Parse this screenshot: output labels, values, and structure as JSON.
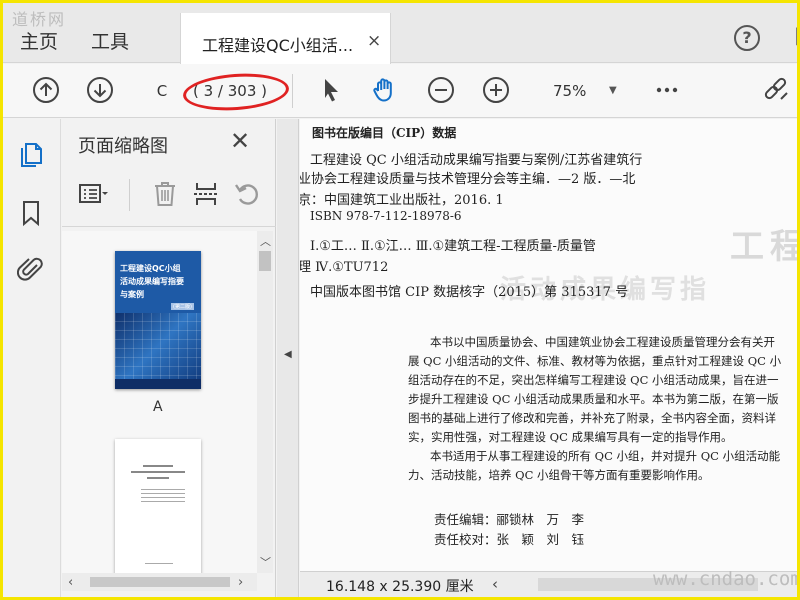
{
  "watermark_top": "道桥网",
  "watermark_bottom": "www.cndao.com",
  "top_tabs": {
    "home": "主页",
    "tools": "工具"
  },
  "document_tab": {
    "title": "工程建设QC小组活...",
    "close": "×"
  },
  "help": "?",
  "toolbar": {
    "current_page": "C",
    "page_count": "( 3 / 303 )",
    "zoom": "75%"
  },
  "panel": {
    "title": "页面缩略图",
    "close": "✕",
    "thumbnails": [
      {
        "label": "A",
        "cover_lines": [
          "工程建设QC小组",
          "活动成果编写指要",
          "与案例"
        ],
        "edition": "(第二版)"
      },
      {
        "label": ""
      }
    ]
  },
  "document": {
    "cip_lines": [
      "图书在版编目（CIP）数据",
      "工程建设 QC 小组活动成果编写指要与案例/江苏省建筑行",
      "业协会工程建设质量与技术管理分会等主编．—2 版．—北",
      "京：中国建筑工业出版社，2016. 1",
      "ISBN 978-7-112-18978-6",
      "Ⅰ.①工…  Ⅱ.①江…  Ⅲ.①建筑工程-工程质量-质量管",
      "理  Ⅳ.①TU712",
      "中国版本图书馆 CIP 数据核字（2015）第 315317 号"
    ],
    "paragraph_lines": [
      "本书以中国质量协会、中国建筑业协会工程建设质量管理分会有关开",
      "展 QC 小组活动的文件、标准、教材等为依据，重点针对工程建设 QC 小",
      "组活动存在的不足，突出怎样编写工程建设 QC 小组活动成果，旨在进一",
      "步提升工程建设 QC 小组活动成果质量和水平。本书为第二版，在第一版",
      "图书的基础上进行了修改和完善，并补充了附录，全书内容全面，资料详",
      "实，实用性强，对工程建设 QC 成果编写具有一定的指导作用。",
      "本书适用于从事工程建设的所有 QC 小组，并对提升 QC 小组活动能",
      "力、活动技能，培养 QC 小组骨干等方面有重要影响作用。"
    ],
    "editor": "责任编辑：郦锁林　万　李",
    "proofreader": "责任校对：张　颖　刘　钰"
  },
  "status": {
    "dimensions": "16.148 x 25.390 厘米"
  }
}
